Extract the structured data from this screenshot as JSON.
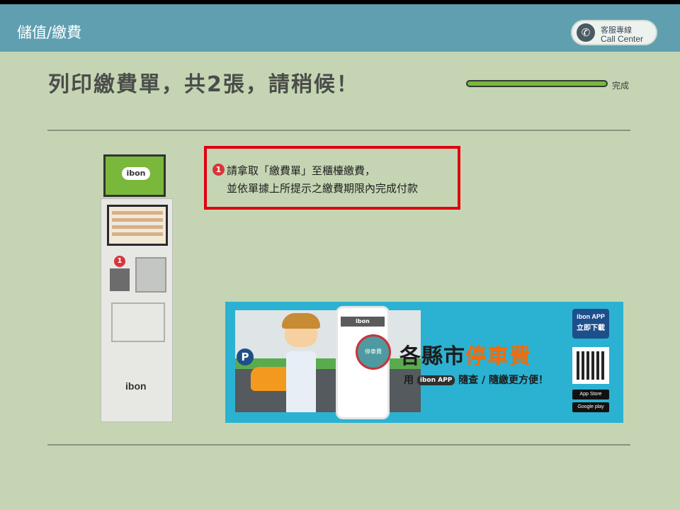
{
  "header": {
    "title": "儲值/繳費",
    "call_center": {
      "line1": "客服專線",
      "line2": "Call Center"
    }
  },
  "main": {
    "headline": "列印繳費單，共2張，請稍候！",
    "progress": {
      "label": "完成",
      "fill_percent": 100,
      "fill_color": "#7ab83c"
    },
    "instruction": {
      "badge": "1",
      "line1": "請拿取「繳費單」至櫃檯繳費，",
      "line2": "並依單據上所提示之繳費期限內完成付款"
    },
    "kiosk": {
      "screen_logo": "ibon",
      "badge": "1",
      "brand": "ibon"
    }
  },
  "banner": {
    "phone_logo": "ibon",
    "phone_highlight": "停車費",
    "headline_a": "各縣市",
    "headline_b": "停車費",
    "subline_prefix": "用",
    "subline_app": "ibon APP",
    "subline_suffix": "隨查 / 隨繳更方便！",
    "app_badge_line1": "ibon APP",
    "app_badge_line2": "立即下載",
    "store1": "App Store",
    "store2": "Google play",
    "parking_sign": "P"
  },
  "colors": {
    "background": "#c5d5b3",
    "header": "#5f9fb0",
    "highlight_border": "#e0000e",
    "banner": "#2bb2d2",
    "accent_orange": "#f46a08"
  }
}
